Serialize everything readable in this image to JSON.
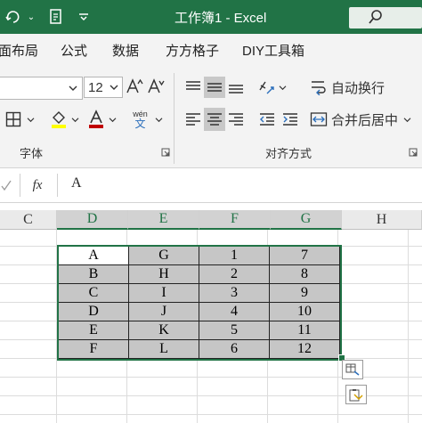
{
  "window": {
    "title": "工作簿1  -  Excel",
    "search_label": ""
  },
  "ribbon": {
    "tabs": [
      "面布局",
      "公式",
      "数据",
      "方方格子",
      "DIY工具箱"
    ],
    "font_size": "12",
    "wrap_text_label": "自动换行",
    "merge_center_label": "合并后居中",
    "group_font": "字体",
    "group_alignment": "对齐方式",
    "font_color": "#c00000",
    "highlight_color": "#ffff00",
    "pinyin_top": "wén",
    "pinyin_bottom": "文"
  },
  "formula_bar": {
    "fx_label": "fx",
    "value": "A"
  },
  "columns": [
    "C",
    "D",
    "E",
    "F",
    "G",
    "H"
  ],
  "table": {
    "rows": [
      [
        "A",
        "G",
        "1",
        "7"
      ],
      [
        "B",
        "H",
        "2",
        "8"
      ],
      [
        "C",
        "I",
        "3",
        "9"
      ],
      [
        "D",
        "J",
        "4",
        "10"
      ],
      [
        "E",
        "K",
        "5",
        "11"
      ],
      [
        "F",
        "L",
        "6",
        "12"
      ]
    ]
  },
  "colors": {
    "excel_green": "#217346",
    "selection_fill": "#c6c6c6"
  }
}
